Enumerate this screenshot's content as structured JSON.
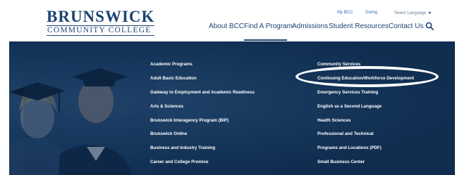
{
  "logo": {
    "line1": "BRUNSWICK",
    "line2": "COMMUNITY COLLEGE"
  },
  "utility_nav": {
    "mybcc": "My BCC",
    "giving": "Giving",
    "language": "Select Language",
    "language_chevron": "▾"
  },
  "main_nav": {
    "about": "About BCC",
    "find": "Find A Program",
    "admissions": "Admissions",
    "student": "Student Resources",
    "contact": "Contact Us"
  },
  "menu": {
    "left": [
      "Academic Programs",
      "Adult Basic Education",
      "Gateway to Employment and Academic Readiness",
      "Arts & Sciences",
      "Brunswick Interagency Program (BIP)",
      "Brunswick Online",
      "Business and Industry Training",
      "Career and College Promise"
    ],
    "right": [
      "Community Services",
      "Continuing Education/Workforce Development",
      "Emergency Services Training",
      "English as a Second Language",
      "Health Sciences",
      "Professional and Technical",
      "Programs and Locations (PDF)",
      "Small Business Center"
    ]
  },
  "colors": {
    "brand_navy": "#1d4473",
    "menu_bg": "#0f2d4f",
    "utility_link": "#2e6fb0",
    "annotation": "#ffffff"
  },
  "icons": {
    "search": "search-icon",
    "chevron": "chevron-down-icon"
  }
}
